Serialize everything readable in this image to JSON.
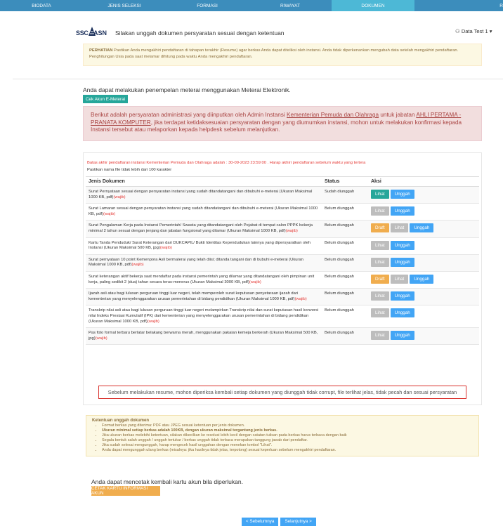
{
  "nav": {
    "tabs": [
      {
        "label": "BIODATA"
      },
      {
        "label": "JENIS SELEKSI"
      },
      {
        "label": "FORMASI"
      },
      {
        "label": "RIWAYAT"
      },
      {
        "label": "DOKUMEN"
      },
      {
        "label": "R"
      }
    ],
    "active_tab": "DOKUMEN",
    "colors": {
      "bar": "#3c8dbc",
      "active": "#4db8d6"
    }
  },
  "header": {
    "logo_left": "SSC",
    "logo_right": "ASN",
    "title": "Silakan unggah dokumen persyaratan sesuai dengan ketentuan",
    "user": "Data Test 1"
  },
  "perhatian": {
    "label": "PERHATIAN",
    "text": "Pastikan Anda mengakhiri pendaftaran di tahapan terakhir (Resume) agar berkas Anda dapat diteliksi oleh instansi. Anda tidak diperkenankan mengubah data setelah mengakhiri pendaftaran. Penghitungan Usia pada saat melamar dihitung pada waktu Anda mengakhiri pendaftaran."
  },
  "meterai": {
    "text": "Anda dapat melakukan penempelan meterai menggunakan Meterai Elektronik.",
    "button": "Cek Akun E-Meterai"
  },
  "requirements_alert": {
    "part1": "Berikut adalah persyaratan administrasi yang diinputkan oleh Admin Instansi ",
    "instansi": "Kementerian Pemuda dan Olahraga",
    "part2": " untuk jabatan ",
    "jabatan": "AHLI PERTAMA - PRANATA KOMPUTER",
    "part3": ", jika terdapat ketidaksesuaian persyaratan dengan yang diumumkan instansi, mohon untuk melakukan konfirmasi kepada Instansi tersebut atau melaporkan kepada helpdesk sebelum melanjutkan."
  },
  "deadline": "Batas akhir pendaftaran instansi Kementerian Pemuda dan Olahraga adalah : 30-09-2023 23:59:00 . Harap akhiri pendaftaran sebelum waktu yang tertera",
  "filename_note": "Pastikan nama file tidak lebih dari 100 karakter",
  "table": {
    "headers": [
      "Jenis Dokumen",
      "Status",
      "Aksi"
    ],
    "wajib_label": "(wajib)",
    "rows": [
      {
        "doc": "Surat Pernyataan sesuai dengan persyaratan instansi yang sudah ditandatangani dan dibubuhi e-meterai (Ukuran Maksimal 1000 KB, pdf)",
        "status": "Sudah diunggah",
        "draft": "",
        "lihat": "Lihat",
        "unggah": "Unggah"
      },
      {
        "doc": "Surat Lamaran sesuai dengan persyaratan instansi yang sudah ditandatangani dan dibubuhi e-meterai (Ukuran Maksimal 1000 KB, pdf)",
        "status": "Belum diunggah",
        "draft": "",
        "lihat": "Lihat",
        "unggah": "Unggah"
      },
      {
        "doc": "Surat Pengalaman Kerja pada Instansi Pemerintah/ Swasta yang ditandatangani oleh Pejabat di tempat calon PPPK bekerja minimal 2 tahun sesuai dengan jenjang dan jabatan fungsional yang dilamar (Ukuran Maksimal 1000 KB, pdf)",
        "status": "Belum diunggah",
        "draft": "Draft",
        "lihat": "Lihat",
        "unggah": "Unggah"
      },
      {
        "doc": "Kartu Tanda Penduduk/ Surat Keterangan dari DUKCAPIL/ Bukti Identitas Kependudukan lainnya yang dipersyaratkan oleh Instansi (Ukuran Maksimal 500 KB, jpg)",
        "status": "Belum diunggah",
        "draft": "",
        "lihat": "Lihat",
        "unggah": "Unggah"
      },
      {
        "doc": "Surat pernyataan 10 point Kemenpora Asli bermaterai yang telah diisi; ditanda tangani dan di bubuhi e-meterai (Ukuran Maksimal 1000 KB, pdf)",
        "status": "Belum diunggah",
        "draft": "",
        "lihat": "Lihat",
        "unggah": "Unggah"
      },
      {
        "doc": "Surat keterangan aktif bekerja saat mendaftar pada instansi pemerintah yang dilamar yang ditandatangani oleh pimpinan unit kerja, paling sedikit 2 (dua) tahun secara terus-menerus (Ukuran Maksimal 3000 KB, pdf)",
        "status": "Belum diunggah",
        "draft": "Draft",
        "lihat": "Lihat",
        "unggah": "Unggah"
      },
      {
        "doc": "Ijazah asli atau bagi lulusan perguruan tinggi luar negeri, telah memperoleh surat keputusan penyetaraan ijazah dari kementerian yang menyelenggarakan urusan pemerintahan di bidang pendidikan (Ukuran Maksimal 1000 KB, pdf)",
        "status": "Belum diunggah",
        "draft": "",
        "lihat": "Lihat",
        "unggah": "Unggah"
      },
      {
        "doc": "Transkrip nilai asli atau bagi lulusan perguruan tinggi luar negeri melampirkan Transkrip nilai dan surat keputusan hasil konversi nilai Indeks Prestasi Kumulatif (IPK) dari kementerian yang menyelenggarakan urusan pemerintahan di bidang pendidikan (Ukuran Maksimal 1000 KB, pdf)",
        "status": "Belum diunggah",
        "draft": "",
        "lihat": "Lihat",
        "unggah": "Unggah"
      },
      {
        "doc": "Pas foto formal terbaru berlatar belakang berwarna merah, menggunakan pakaian kemeja berkerah (Ukuran Maksimal 500 KB, jpg)",
        "status": "Belum diunggah",
        "draft": "",
        "lihat": "Lihat",
        "unggah": "Unggah"
      }
    ]
  },
  "resume_note": "Sebelum melakukan resume, mohon diperiksa kembali setiap dokumen yang diunggah tidak corrupt, file terlihat jelas, tidak pecah dan sesuai persyaratan",
  "ketentuan": {
    "title": "Ketentuan unggah dokumen",
    "items": [
      "Format berkas yang diterima: PDF atau JPEG sesuai ketentuan per jenis dokumen.",
      "Ukuran minimal setiap berkas adalah 100KB, dengan ukuran maksimal tergantung jenis berkas.",
      "Jika ukuran berkas melebihi ketentuan, silakan dikecilkan ke resolusi lebih kecil dengan catatan tulisan pada berkas harus terbaca dengan baik",
      "Segala bentuk salah unggah / unggah tertukar / berkas unggah tidak terbaca merupakan tanggung jawab dari pendaftar.",
      "Jika sudah selesai mengunggah, harap mengecek hasil unggahan dengan menekan tombol \"Lihat\".",
      "Anda dapat mengunggah ulang berkas (misalnya: jika hasilnya tidak jelas, terpotong) sesuai keperluan sebelum mengakhiri pendaftaran."
    ]
  },
  "cetak": {
    "text": "Anda dapat mencetak kembali kartu akun bila diperlukan.",
    "button": "CETAK KARTU INFORMASI AKUN"
  },
  "pager": {
    "prev": "< Sebelumnya",
    "next": "Selanjutnya >"
  }
}
